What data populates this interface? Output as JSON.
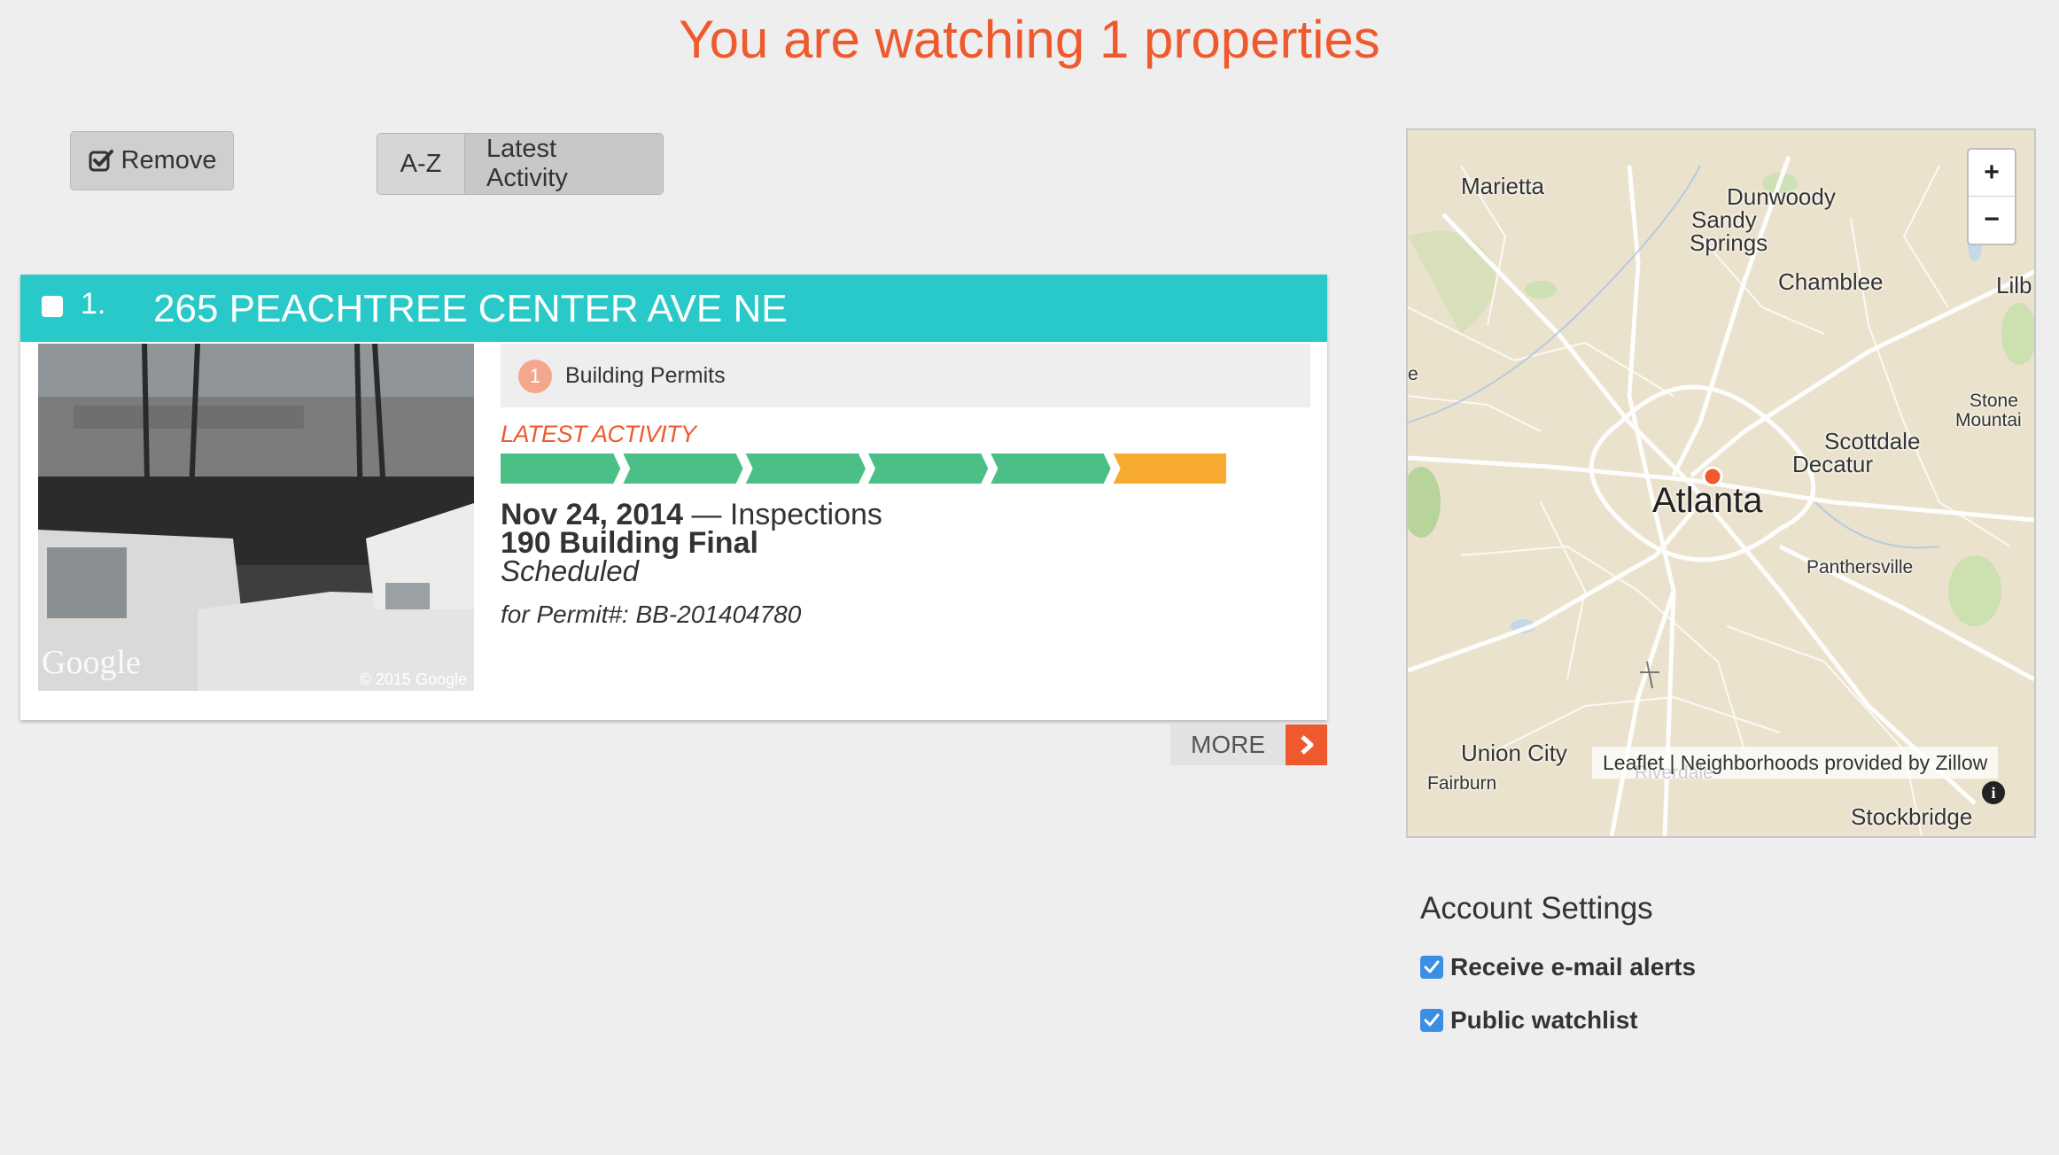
{
  "header": {
    "title": "You are watching 1 properties"
  },
  "toolbar": {
    "remove_label": "Remove",
    "sort_options": [
      "A-Z",
      "Latest Activity"
    ],
    "sort_selected": "Latest Activity"
  },
  "properties": [
    {
      "index": "1.",
      "address": "265 PEACHTREE CENTER AVE NE",
      "photo": {
        "watermark": "Google",
        "copyright": "© 2015 Google"
      },
      "permits_count": "1",
      "permits_label": "Building Permits",
      "latest_activity_label": "LATEST ACTIVITY",
      "progress": {
        "steps_total": 6,
        "steps_completed": 5,
        "completed_color": "#4cbf87",
        "current_color": "#f6aa2f"
      },
      "activity_date": "Nov 24, 2014",
      "activity_type": " — Inspections",
      "activity_title": "190 Building Final",
      "activity_status": "Scheduled",
      "activity_permit": "for Permit#: BB-201404780"
    }
  ],
  "more_label": "MORE",
  "map": {
    "zoom_in": "+",
    "zoom_out": "−",
    "attribution": "Leaflet | Neighborhoods provided by Zillow",
    "marker_color": "#ee5a2e",
    "labels": {
      "marietta": "Marietta",
      "dunwoody": "Dunwoody",
      "sandy": "Sandy",
      "springs": "Springs",
      "chamblee": "Chamblee",
      "lilb": "Lilb",
      "e": "e",
      "stone": "Stone",
      "mountai": "Mountai",
      "scottdale": "Scottdale",
      "decatur": "Decatur",
      "atlanta": "Atlanta",
      "panthersville": "Panthersville",
      "union_city": "Union City",
      "fairburn": "Fairburn",
      "riverdale": "Riverdale",
      "stockbridge": "Stockbridge"
    }
  },
  "settings": {
    "title": "Account Settings",
    "email_alerts": "Receive e-mail alerts",
    "public_watchlist": "Public watchlist",
    "email_alerts_checked": true,
    "public_watchlist_checked": true
  },
  "colors": {
    "accent": "#ee5a2e",
    "header_teal": "#2ac9c9",
    "checkbox_blue": "#3a8ee6"
  }
}
